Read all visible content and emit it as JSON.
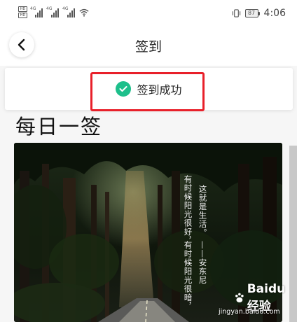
{
  "status_bar": {
    "hd1": "HD",
    "hd2": "HD",
    "sig1_label": "4G",
    "sig2_label": "4G",
    "sig3_label": "4G",
    "battery": "87",
    "time": "4:06"
  },
  "header": {
    "title": "签到"
  },
  "toast": {
    "message": "签到成功",
    "icon": "check-circle-icon",
    "icon_color": "#1dbf8b",
    "highlight_color": "#e8202a"
  },
  "section": {
    "title": "每日一签"
  },
  "photo": {
    "poem_col1": "这就是生活。",
    "poem_col2": "——安东尼",
    "poem_col3": "有时候阳光很好，",
    "poem_col4": "有时候阳光很暗，",
    "watermark_brand": "Baidu经验",
    "watermark_url": "jingyan.baidu.com"
  }
}
